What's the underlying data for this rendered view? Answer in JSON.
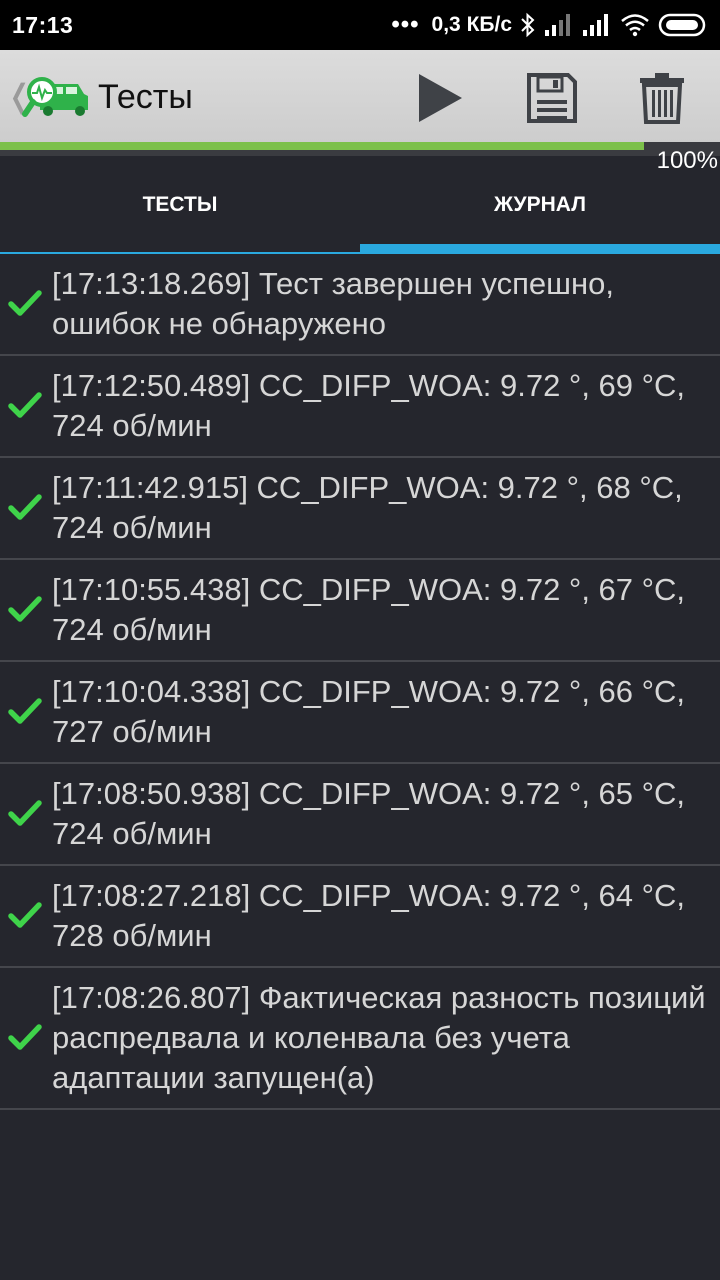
{
  "status_bar": {
    "time": "17:13",
    "dots": "•••",
    "speed": "0,3 КБ/с"
  },
  "toolbar": {
    "title": "Тесты",
    "back_icon": "chevron-left-icon",
    "logo_icon": "car-diagnostics-logo-icon",
    "play_icon": "play-icon",
    "save_icon": "save-icon",
    "delete_icon": "trash-icon"
  },
  "progress": {
    "value": 100,
    "label": "100%"
  },
  "tabs": [
    {
      "label": "ТЕСТЫ",
      "active": false
    },
    {
      "label": "ЖУРНАЛ",
      "active": true
    }
  ],
  "colors": {
    "accent_blue": "#2aa9df",
    "progress_green": "#7cc04a",
    "check_green": "#3fd34a",
    "background": "#25262d"
  },
  "log": [
    {
      "text": "[17:13:18.269] Тест завершен успешно, ошибок не обнаружено"
    },
    {
      "text": "[17:12:50.489] CC_DIFP_WOA: 9.72 °, 69 °C, 724 об/мин"
    },
    {
      "text": "[17:11:42.915] CC_DIFP_WOA: 9.72 °, 68 °C, 724 об/мин"
    },
    {
      "text": "[17:10:55.438] CC_DIFP_WOA: 9.72 °, 67 °C, 724 об/мин"
    },
    {
      "text": "[17:10:04.338] CC_DIFP_WOA: 9.72 °, 66 °C, 727 об/мин"
    },
    {
      "text": "[17:08:50.938] CC_DIFP_WOA: 9.72 °, 65 °C, 724 об/мин"
    },
    {
      "text": "[17:08:27.218] CC_DIFP_WOA: 9.72 °, 64 °C, 728 об/мин"
    },
    {
      "text": "[17:08:26.807] Фактическая разность позиций распредвала и коленвала без учета адаптации запущен(а)"
    }
  ]
}
